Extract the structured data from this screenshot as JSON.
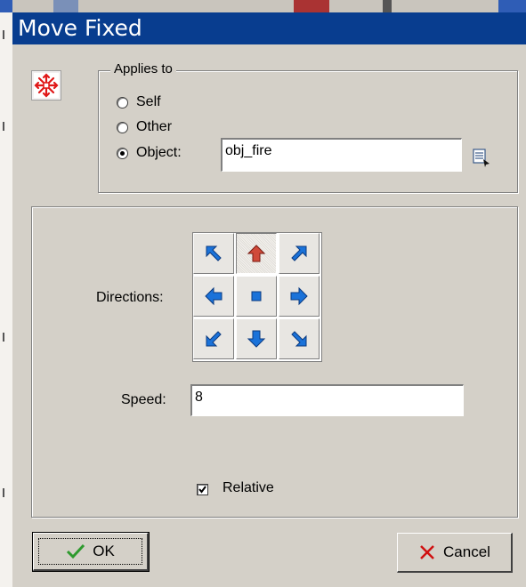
{
  "window": {
    "title": "Move Fixed"
  },
  "applies_to": {
    "legend": "Applies to",
    "options": [
      {
        "label": "Self",
        "checked": false
      },
      {
        "label": "Other",
        "checked": false
      },
      {
        "label": "Object:",
        "checked": true
      }
    ],
    "object_value": "obj_fire"
  },
  "directions": {
    "label": "Directions:",
    "buttons": [
      {
        "name": "up-left",
        "active": false
      },
      {
        "name": "up",
        "active": true
      },
      {
        "name": "up-right",
        "active": false
      },
      {
        "name": "left",
        "active": false
      },
      {
        "name": "stop",
        "active": false
      },
      {
        "name": "right",
        "active": false
      },
      {
        "name": "down-left",
        "active": false
      },
      {
        "name": "down",
        "active": false
      },
      {
        "name": "down-right",
        "active": false
      }
    ]
  },
  "speed": {
    "label": "Speed:",
    "value": "8"
  },
  "relative": {
    "label": "Relative",
    "checked": true
  },
  "buttons": {
    "ok": "OK",
    "cancel": "Cancel"
  },
  "colors": {
    "title_bar": "#083d8f",
    "arrow_blue": "#1a72d9",
    "arrow_red": "#c0392b",
    "ok_check": "#2e9a2e",
    "cancel_x": "#d01010"
  }
}
